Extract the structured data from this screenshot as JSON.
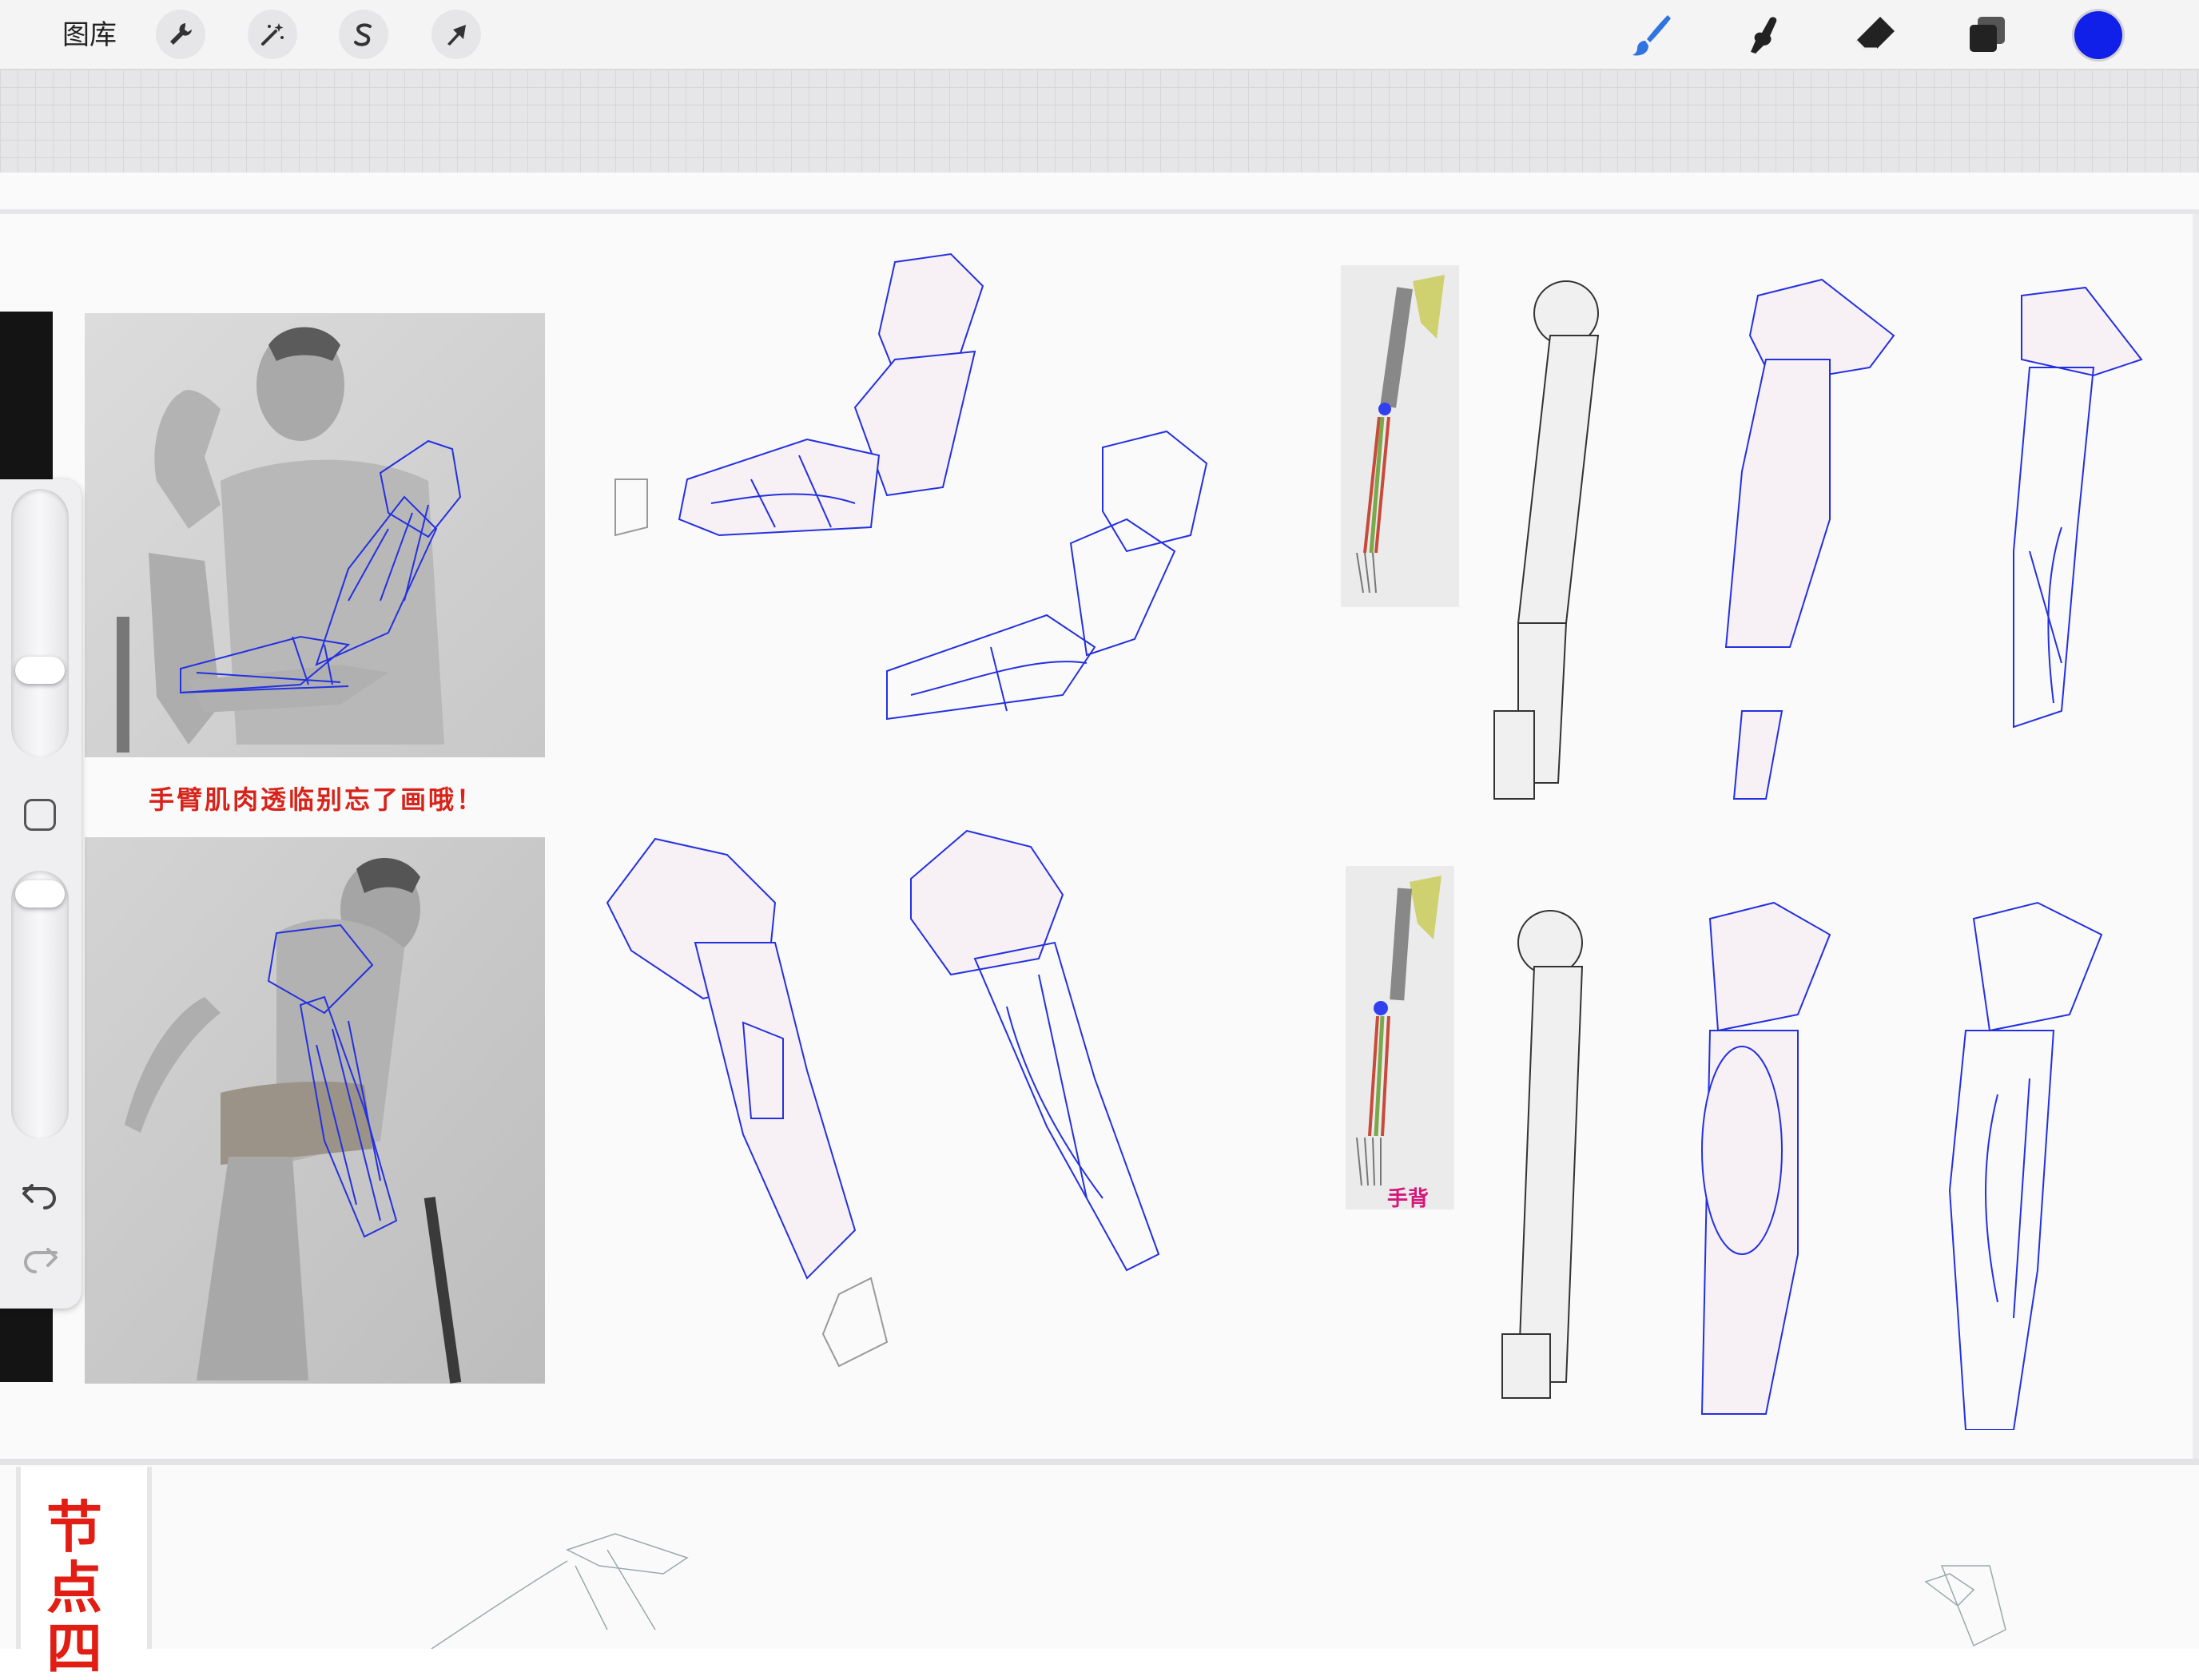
{
  "toolbar": {
    "gallery_label": "图库",
    "left_tools": [
      {
        "name": "wrench-icon"
      },
      {
        "name": "magic-wand-icon"
      },
      {
        "name": "selection-icon"
      },
      {
        "name": "transform-arrow-icon"
      }
    ],
    "right_tools": [
      {
        "name": "brush-icon"
      },
      {
        "name": "smudge-icon"
      },
      {
        "name": "eraser-icon"
      },
      {
        "name": "layers-icon"
      },
      {
        "name": "color-swatch"
      }
    ],
    "active_color": "#1020e8",
    "brush_color": "#2f74e0"
  },
  "side_panel": {
    "brush_size_level": 0.5,
    "opacity_level": 0.9,
    "undo_icon": "undo-icon",
    "redo_icon": "redo-icon",
    "modify_icon": "square-icon"
  },
  "canvas": {
    "caption": "手臂肌肉透临别忘了画哦！",
    "bone_label": "手背",
    "bottom_title": "节点四",
    "colors": {
      "caption": "#d8231a",
      "bone_label": "#d6177a",
      "outline": "#2430e0"
    }
  }
}
